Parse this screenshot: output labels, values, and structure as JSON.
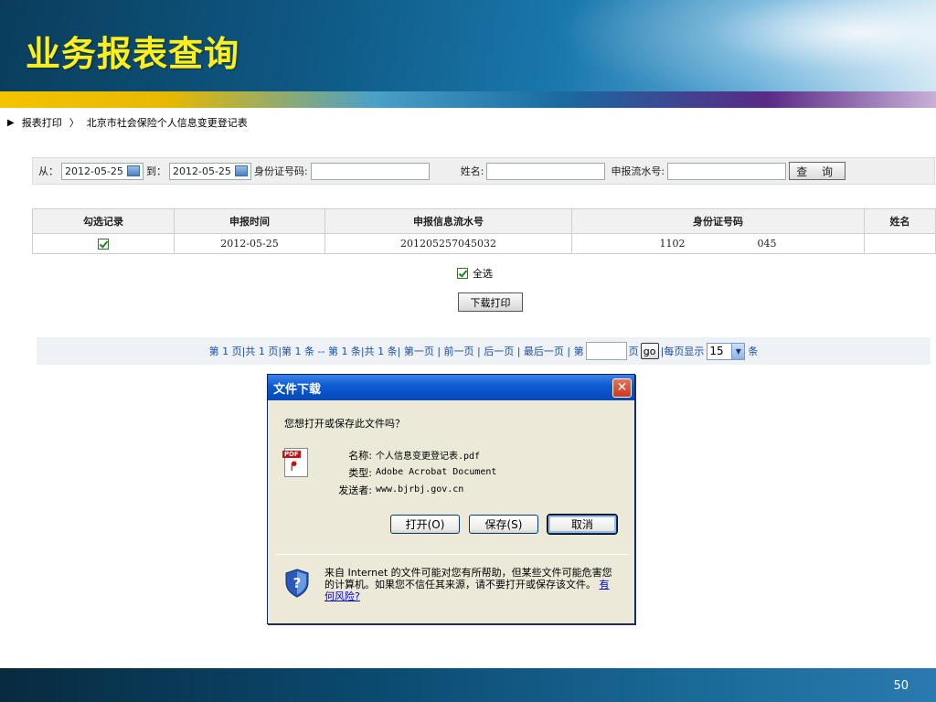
{
  "slide": {
    "title": "业务报表查询",
    "page_number": "50"
  },
  "breadcrumb": {
    "root": "报表打印",
    "separator": "〉",
    "current": "北京市社会保险个人信息变更登记表"
  },
  "search": {
    "from_label": "从：",
    "from_value": "2012-05-25",
    "to_label": "到：",
    "to_value": "2012-05-25",
    "id_label": "身份证号码:",
    "name_label": "姓名:",
    "serial_label": "申报流水号:",
    "query_button": "查 询"
  },
  "table": {
    "headers": [
      "勾选记录",
      "申报时间",
      "申报信息流水号",
      "身份证号码",
      "姓名"
    ],
    "rows": [
      {
        "checked": true,
        "time": "2012-05-25",
        "serial": "201205257045032",
        "id_prefix": "1102",
        "id_suffix": "045",
        "name": ""
      }
    ]
  },
  "select_all": {
    "label": "全选",
    "checked": true
  },
  "download_button": "下载打印",
  "pager": {
    "text": "第 1 页|共 1 页|第 1 条 -- 第 1 条|共 1 条| 第一页 | 前一页 | 后一页 | 最后一页 | 第",
    "page_suffix": "页",
    "go": "go",
    "per_page_label": "|每页显示",
    "per_page_value": "15",
    "per_page_unit": "条"
  },
  "dialog": {
    "title": "文件下载",
    "question": "您想打开或保存此文件吗？",
    "name_key": "名称:",
    "name_value": "个人信息变更登记表.pdf",
    "type_key": "类型:",
    "type_value": "Adobe Acrobat Document",
    "from_key": "发送者:",
    "from_value": "www.bjrbj.gov.cn",
    "open_button": "打开(O)",
    "save_button": "保存(S)",
    "cancel_button": "取消",
    "warning": "来自 Internet 的文件可能对您有所帮助，但某些文件可能危害您的计算机。如果您不信任其来源，请不要打开或保存该文件。",
    "risk_link": "有何风险?"
  }
}
